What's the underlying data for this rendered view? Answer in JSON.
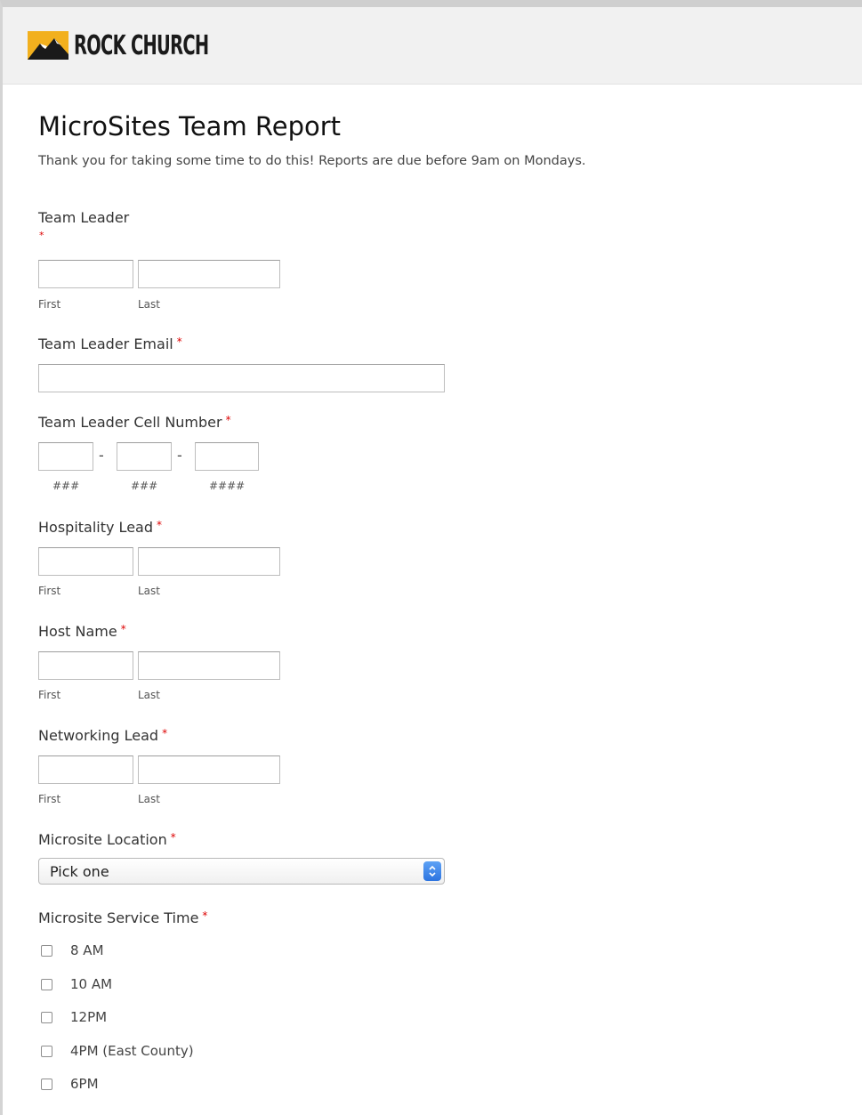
{
  "header": {
    "brand_name": "ROCK CHURCH",
    "logo_icon": "mountain-logo-icon"
  },
  "form": {
    "title": "MicroSites Team Report",
    "description": "Thank you for taking some time to do this! Reports are due before 9am on Mondays.",
    "required_marker": "*",
    "fields": {
      "team_leader": {
        "label": "Team Leader",
        "first_sublabel": "First",
        "last_sublabel": "Last",
        "first_value": "",
        "last_value": ""
      },
      "team_leader_email": {
        "label": "Team Leader Email",
        "value": ""
      },
      "team_leader_cell": {
        "label": "Team Leader Cell Number",
        "separator": "-",
        "area_sublabel": "###",
        "prefix_sublabel": "###",
        "line_sublabel": "####"
      },
      "hospitality_lead": {
        "label": "Hospitality Lead",
        "first_sublabel": "First",
        "last_sublabel": "Last"
      },
      "host_name": {
        "label": "Host Name",
        "first_sublabel": "First",
        "last_sublabel": "Last"
      },
      "networking_lead": {
        "label": "Networking Lead",
        "first_sublabel": "First",
        "last_sublabel": "Last"
      },
      "microsite_location": {
        "label": "Microsite Location",
        "selected": "Pick one"
      },
      "microsite_service_time": {
        "label": "Microsite Service Time",
        "options": [
          "8 AM",
          "10 AM",
          "12PM",
          "4PM (East County)",
          "6PM"
        ]
      }
    }
  },
  "colors": {
    "required": "#dd0000",
    "header_bg": "#f1f1f1",
    "select_arrow": "#2d74e0"
  }
}
